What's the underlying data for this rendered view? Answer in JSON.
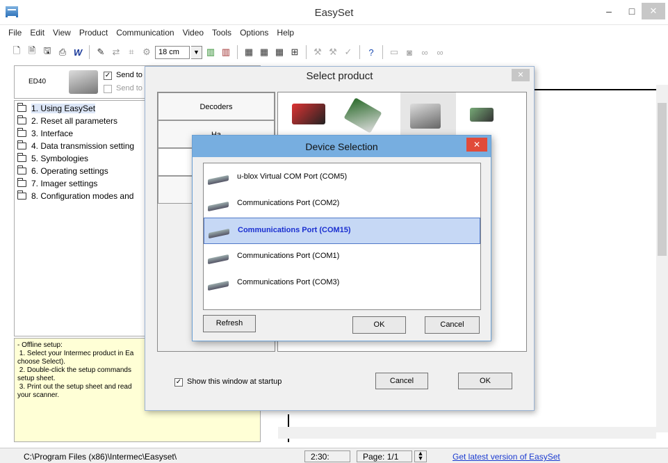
{
  "window": {
    "title": "EasySet",
    "minimize_glyph": "–",
    "maximize_glyph": "□",
    "close_glyph": "✕"
  },
  "menu": [
    "File",
    "Edit",
    "View",
    "Product",
    "Communication",
    "Video",
    "Tools",
    "Options",
    "Help"
  ],
  "toolbar": {
    "distance_value": "18 cm"
  },
  "left_header": {
    "device_label": "ED40",
    "send_to_label_1": "Send to",
    "send_to_label_2": "Send to",
    "send_to_checked_1": "✓",
    "send_to_checked_2": ""
  },
  "tree": [
    "1. Using EasySet",
    "2. Reset all parameters",
    "3. Interface",
    "4. Data transmission setting",
    "5. Symbologies",
    "6. Operating settings",
    "7. Imager settings",
    "8. Configuration modes and"
  ],
  "info_text": "- Offline setup:\n 1. Select your Intermec product in Ea\nchoose Select).\n 2. Double-click the setup commands\nsetup sheet.\n 3. Print out the setup sheet and read\nyour scanner.",
  "status": {
    "path": "C:\\Program Files (x86)\\Intermec\\Easyset\\",
    "time": "2:30:",
    "page": "Page: 1/1",
    "link": "Get latest version of EasySet"
  },
  "select_product": {
    "title": "Select product",
    "close_glyph": "✕",
    "tabs": [
      "Decoders",
      "Ha",
      "",
      "Ha"
    ],
    "show_at_startup_label": "Show this window at startup",
    "show_at_startup_checked": "✓",
    "cancel_label": "Cancel",
    "ok_label": "OK"
  },
  "device_selection": {
    "title": "Device Selection",
    "close_glyph": "✕",
    "ports": [
      "u-blox Virtual COM Port (COM5)",
      "Communications Port (COM2)",
      "Communications Port (COM15)",
      "Communications Port (COM1)",
      "Communications Port (COM3)"
    ],
    "selected_index": 2,
    "refresh_label": "Refresh",
    "ok_label": "OK",
    "cancel_label": "Cancel"
  }
}
